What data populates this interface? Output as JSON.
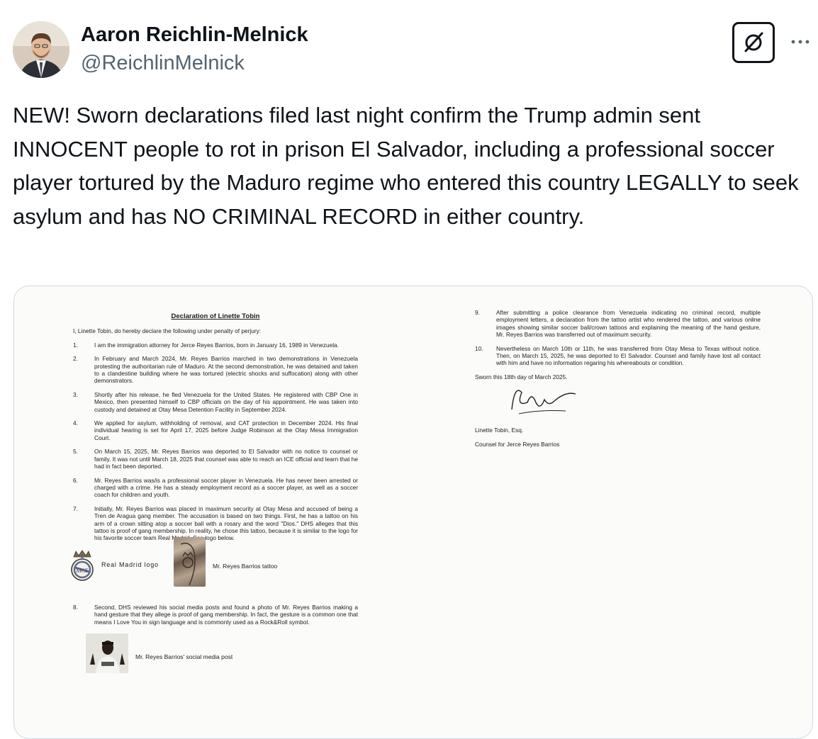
{
  "author": {
    "name": "Aaron Reichlin-Melnick",
    "handle": "@ReichlinMelnick",
    "avatar_icon": "profile-photo"
  },
  "actions": {
    "grok_icon": "grok-icon",
    "more_icon": "more-horizontal-icon",
    "more_glyph": "···"
  },
  "tweet": {
    "text": "NEW! Sworn declarations filed last night confirm the Trump admin sent INNOCENT people to rot in prison El Salvador, including a professional soccer player tortured by the Maduro regime who entered this country LEGALLY to seek asylum and has NO CRIMINAL RECORD in either country."
  },
  "document": {
    "title": "Declaration of Linette Tobin",
    "intro": "I, Linette Tobin, do hereby declare the following under penalty of perjury:",
    "paragraphs": [
      {
        "num": "1.",
        "text": "I am the immigration attorney for Jerce Reyes Barrios, born in January 16, 1989 in Venezuela."
      },
      {
        "num": "2.",
        "text": "In February and March 2024, Mr. Reyes Barrios marched in two demonstrations in Venezuela protesting the authoritarian rule of Maduro. At the second demonstration, he was detained and taken to a clandestine building where he was tortured (electric shocks and suffocation) along with other demonstrators."
      },
      {
        "num": "3.",
        "text": "Shortly after his release, he fled Venezuela for the United States. He registered with CBP One in Mexico, then presented himself to CBP officials on the day of his appointment. He was taken into custody and detained at Otay Mesa Detention Facility in September 2024."
      },
      {
        "num": "4.",
        "text": "We applied for asylum, withholding of removal, and CAT protection in December 2024. His final individual hearing is set for April 17, 2025 before Judge Robinson at the Otay Mesa Immigration Court."
      },
      {
        "num": "5.",
        "text": "On March 15, 2025, Mr. Reyes Barrios was deported to El Salvador with no notice to counsel or family. It was not until March 18, 2025 that counsel was able to reach an ICE official and learn that he had in fact been deported."
      },
      {
        "num": "6.",
        "text": "Mr. Reyes Barrios was/is a professional soccer player in Venezuela. He has never been arrested or charged with a crime. He has a steady employment record as a soccer player, as well as a soccer coach for children and youth."
      },
      {
        "num": "7.",
        "text": "Initially, Mr. Reyes Barrios was placed in maximum security at Otay Mesa and accused of being a Tren de Aragua gang member. The accusation is based on two things. First, he has a tattoo on his arm of a crown sitting atop a soccer ball with a rosary and the word \"Dios.\" DHS alleges that this tattoo is proof of gang membership. In reality, he chose this tattoo, because it is similar to the logo for his favorite soccer team Real Madrid. See logo below."
      }
    ],
    "logo_label": "Real Madrid logo",
    "tattoo_label": "Mr. Reyes Barrios tattoo",
    "paragraph8": {
      "num": "8.",
      "text": "Second, DHS reviewed his social media posts and found a photo of Mr. Reyes Barrios making a hand gesture that they allege is proof of gang membership. In fact, the gesture is a common one that means I Love You in sign language and is commonly used as a Rock&Roll symbol."
    },
    "social_label": "Mr. Reyes Barrios' social media post",
    "right_paragraphs": [
      {
        "num": "9.",
        "text": "After submitting a police clearance from Venezuela indicating no criminal record, multiple employment letters, a declaration from the tattoo artist who rendered the tattoo, and various online images showing similar soccer ball/crown tattoos and explaining the meaning of the hand gesture, Mr. Reyes Barrios was transferred out of maximum security."
      },
      {
        "num": "10.",
        "text": "Nevertheless on March 10th or 11th, he was transferred from Otay Mesa to Texas without notice. Then, on March 15, 2025, he was deported to El Salvador. Counsel and family have lost all contact with him and have no information regaring his whereabouts or condition."
      }
    ],
    "sworn": "Sworn this 18th day of March 2025.",
    "signer_name": "Linette Tobin, Esq.",
    "signer_role": "Counsel for Jerce Reyes Barrios"
  }
}
